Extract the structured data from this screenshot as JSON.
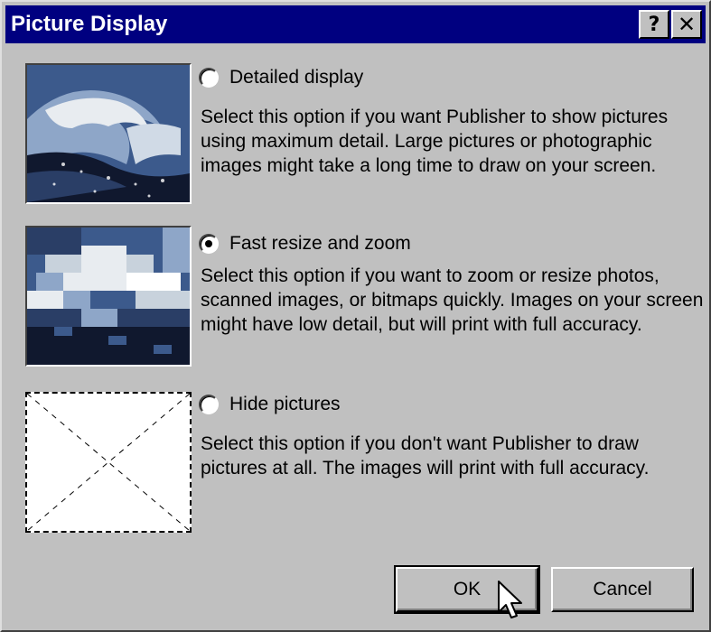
{
  "dialog": {
    "title": "Picture Display",
    "help_button": "?",
    "close_button": "✕"
  },
  "options": [
    {
      "id": "detailed",
      "label": "Detailed display",
      "selected": false,
      "description": "Select this option if you want Publisher to show pictures using maximum detail. Large pictures or photographic images might take a long time to draw on your screen."
    },
    {
      "id": "fast",
      "label": "Fast resize and zoom",
      "selected": true,
      "description": "Select this option if you want to zoom or resize photos, scanned images, or bitmaps quickly. Images on your screen might have low detail, but will print with full accuracy."
    },
    {
      "id": "hide",
      "label": "Hide pictures",
      "selected": false,
      "description": "Select this option if you don't want Publisher to draw pictures at all. The images will print with full accuracy."
    }
  ],
  "buttons": {
    "ok": "OK",
    "cancel": "Cancel"
  },
  "icons": {
    "thumb_detailed": "wave-photo-detailed",
    "thumb_fast": "wave-photo-pixelated",
    "thumb_hide": "hidden-picture-placeholder",
    "cursor": "mouse-pointer-icon"
  },
  "colors": {
    "titlebar": "#000080",
    "face": "#c0c0c0",
    "wave_dark": "#10182e",
    "wave_mid": "#3c5a8c",
    "wave_light": "#e8ecf0"
  }
}
